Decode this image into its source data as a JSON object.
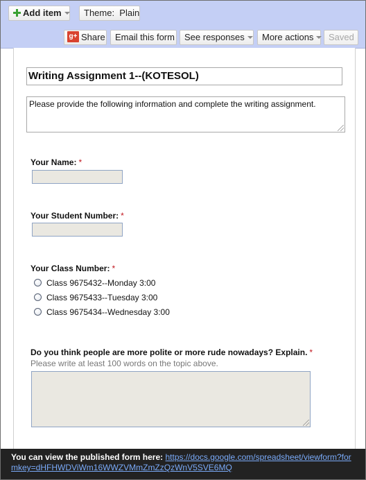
{
  "toolbar": {
    "add_item_label": "Add item",
    "theme_label": "Theme:  Plain",
    "share_icon_text": "g+",
    "share_label": "Share",
    "email_label": "Email this form",
    "responses_label": "See responses",
    "more_actions_label": "More actions",
    "saved_label": "Saved"
  },
  "form": {
    "title": "Writing Assignment 1--(KOTESOL)",
    "description": "Please provide the following information and complete the writing assignment.",
    "required_marker": "*",
    "questions": [
      {
        "label": "Your Name:"
      },
      {
        "label": "Your Student Number:"
      },
      {
        "label": "Your Class Number:",
        "options": [
          "Class 9675432--Monday 3:00",
          "Class 9675433--Tuesday 3:00",
          "Class 9675434--Wednesday 3:00"
        ]
      },
      {
        "label": "Do you think people are more polite or more rude nowadays? Explain.",
        "help": "Please write at least 100 words on the topic above."
      }
    ]
  },
  "footer": {
    "text": "You can view the published form here:",
    "link": "https://docs.google.com/spreadsheet/viewform?formkey=dHFHWDViWm16WWZVMmZmZzQzWnV5SVE6MQ"
  },
  "colors": {
    "toolbar_bg": "#c4cff5",
    "footer_bg": "#222222",
    "required": "#c0161e",
    "link": "#7aaaf8"
  }
}
